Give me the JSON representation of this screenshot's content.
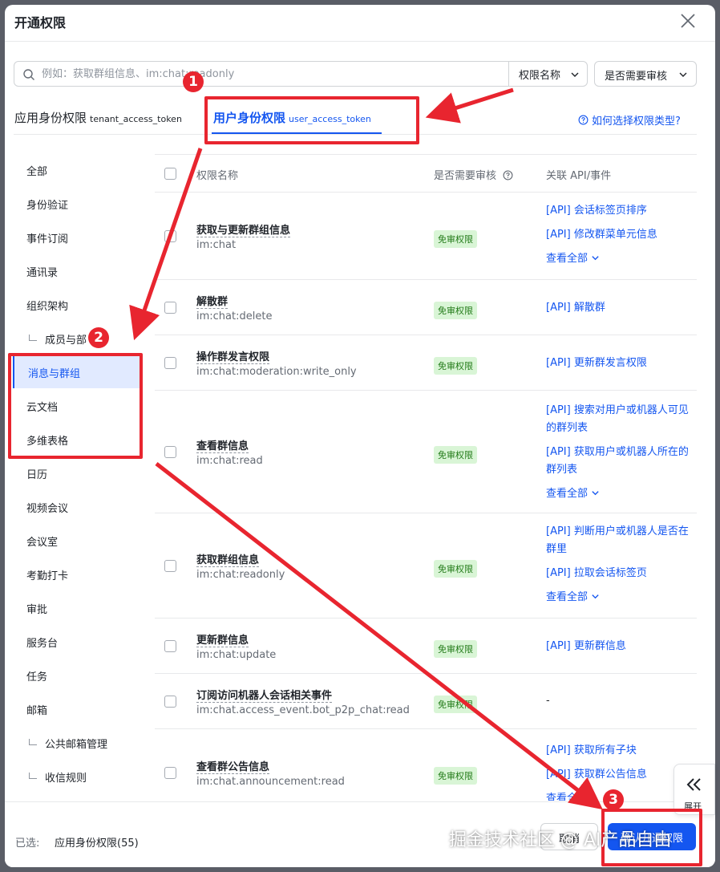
{
  "dialog": {
    "title": "开通权限"
  },
  "search": {
    "placeholder": "例如：获取群组信息、im:chat:readonly",
    "value": "",
    "perm_name_filter": "权限名称",
    "review_filter": "是否需要审核"
  },
  "tabs": {
    "tenant": {
      "label": "应用身份权限",
      "token": "tenant_access_token"
    },
    "user": {
      "label": "用户身份权限",
      "token": "user_access_token"
    },
    "help": "如何选择权限类型?"
  },
  "sidebar": {
    "items": [
      {
        "label": "全部",
        "child": false,
        "active": false
      },
      {
        "label": "身份验证",
        "child": false,
        "active": false
      },
      {
        "label": "事件订阅",
        "child": false,
        "active": false
      },
      {
        "label": "通讯录",
        "child": false,
        "active": false
      },
      {
        "label": "组织架构",
        "child": false,
        "active": false
      },
      {
        "label": "成员与部",
        "child": true,
        "active": false
      },
      {
        "label": "消息与群组",
        "child": false,
        "active": true
      },
      {
        "label": "云文档",
        "child": false,
        "active": false
      },
      {
        "label": "多维表格",
        "child": false,
        "active": false
      },
      {
        "label": "日历",
        "child": false,
        "active": false
      },
      {
        "label": "视频会议",
        "child": false,
        "active": false
      },
      {
        "label": "会议室",
        "child": false,
        "active": false
      },
      {
        "label": "考勤打卡",
        "child": false,
        "active": false
      },
      {
        "label": "审批",
        "child": false,
        "active": false
      },
      {
        "label": "服务台",
        "child": false,
        "active": false
      },
      {
        "label": "任务",
        "child": false,
        "active": false
      },
      {
        "label": "邮箱",
        "child": false,
        "active": false
      },
      {
        "label": "公共邮箱管理",
        "child": true,
        "active": false
      },
      {
        "label": "收信规则",
        "child": true,
        "active": false
      }
    ]
  },
  "table": {
    "headers": {
      "name": "权限名称",
      "review": "是否需要审核",
      "api": "关联 API/事件"
    },
    "rows": [
      {
        "title": "获取与更新群组信息",
        "code": "im:chat",
        "badge": "免审权限",
        "apis": [
          "[API] 会话标签页排序",
          "[API] 修改群菜单元信息"
        ],
        "more": "查看全部"
      },
      {
        "title": "解散群",
        "code": "im:chat:delete",
        "badge": "免审权限",
        "apis": [
          "[API] 解散群"
        ],
        "more": ""
      },
      {
        "title": "操作群发言权限",
        "code": "im:chat:moderation:write_only",
        "badge": "免审权限",
        "apis": [
          "[API] 更新群发言权限"
        ],
        "more": ""
      },
      {
        "title": "查看群信息",
        "code": "im:chat:read",
        "badge": "免审权限",
        "apis": [
          "[API] 搜索对用户或机器人可见的群列表",
          "[API] 获取用户或机器人所在的群列表"
        ],
        "more": "查看全部"
      },
      {
        "title": "获取群组信息",
        "code": "im:chat:readonly",
        "badge": "免审权限",
        "apis": [
          "[API] 判断用户或机器人是否在群里",
          "[API] 拉取会话标签页"
        ],
        "more": "查看全部"
      },
      {
        "title": "更新群信息",
        "code": "im:chat:update",
        "badge": "免审权限",
        "apis": [
          "[API] 更新群信息"
        ],
        "more": ""
      },
      {
        "title": "订阅访问机器人会话相关事件",
        "code": "im:chat.access_event.bot_p2p_chat:read",
        "badge": "免审权限",
        "apis": [],
        "dash": "-",
        "more": ""
      },
      {
        "title": "查看群公告信息",
        "code": "im:chat.announcement:read",
        "badge": "免审权限",
        "apis": [
          "[API] 获取所有子块",
          "[API] 获取群公告信息"
        ],
        "more": "查看全部"
      }
    ]
  },
  "footer": {
    "selected_label": "已选:",
    "selected_value": "应用身份权限(55)",
    "cancel": "取消",
    "confirm": "确认开通权限"
  },
  "expand_tab": {
    "label": "展开"
  },
  "annotations": {
    "one": "1",
    "two": "2",
    "three": "3",
    "color": "#e8252f"
  },
  "watermark": "掘金技术社区 @ AI产品自由",
  "colors": {
    "accent": "#1456f0",
    "badge_bg": "#d9f5d6",
    "badge_text": "#237b19"
  }
}
